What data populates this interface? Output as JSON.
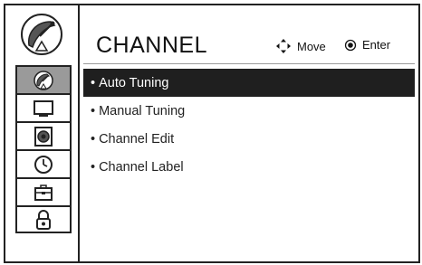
{
  "header": {
    "title": "CHANNEL"
  },
  "hints": {
    "move_label": "Move",
    "enter_label": "Enter"
  },
  "sidebar": {
    "hero_icon": "satellite-dish-icon",
    "items": [
      {
        "icon": "satellite-dish-icon",
        "active": true
      },
      {
        "icon": "tv-monitor-icon",
        "active": false
      },
      {
        "icon": "speaker-icon",
        "active": false
      },
      {
        "icon": "clock-icon",
        "active": false
      },
      {
        "icon": "toolbox-icon",
        "active": false
      },
      {
        "icon": "padlock-icon",
        "active": false
      }
    ]
  },
  "menu": {
    "items": [
      {
        "label": "Auto Tuning",
        "selected": true
      },
      {
        "label": "Manual Tuning",
        "selected": false
      },
      {
        "label": "Channel Edit",
        "selected": false
      },
      {
        "label": "Channel Label",
        "selected": false
      }
    ]
  },
  "colors": {
    "selected_bg": "#1f1f1f",
    "active_nav_bg": "#9a9a9a"
  }
}
